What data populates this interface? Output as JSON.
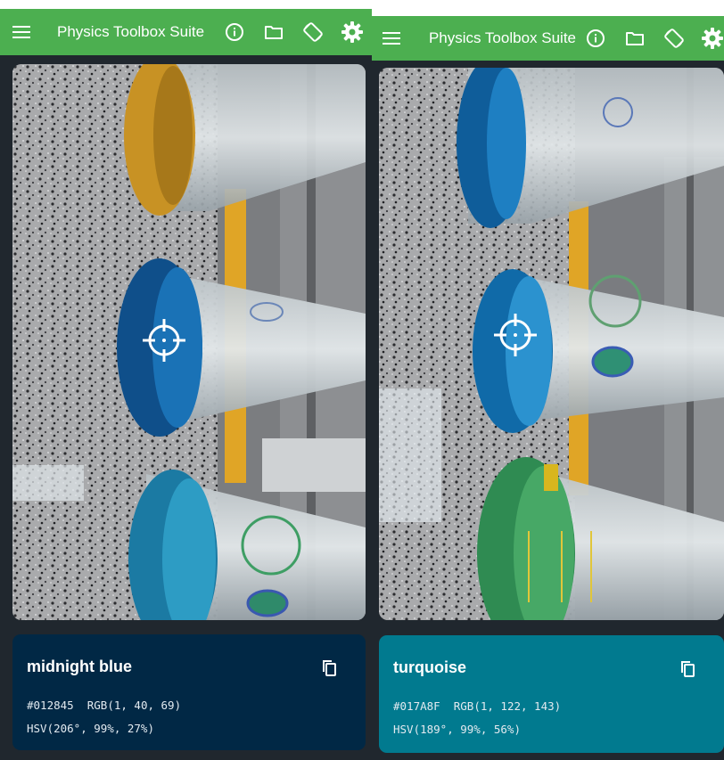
{
  "panels": [
    {
      "app_title": "Physics Toolbox Suite",
      "color": {
        "name": "midnight blue",
        "hex": "#012845",
        "rgb_text": "RGB(1, 40, 69)",
        "hsv_text": "HSV(206°, 99%, 27%)",
        "card_bg": "#012845"
      }
    },
    {
      "app_title": "Physics Toolbox Suite",
      "color": {
        "name": "turquoise",
        "hex": "#017A8F",
        "rgb_text": "RGB(1, 122, 143)",
        "hsv_text": "HSV(189°, 99%, 56%)",
        "card_bg": "#017A8F"
      }
    }
  ],
  "theme": {
    "appbar": "#4caf50",
    "background": "#20272e"
  },
  "icons": [
    "menu-icon",
    "info-icon",
    "folder-icon",
    "rotate-icon",
    "gear-icon",
    "crosshair-icon",
    "copy-icon"
  ]
}
